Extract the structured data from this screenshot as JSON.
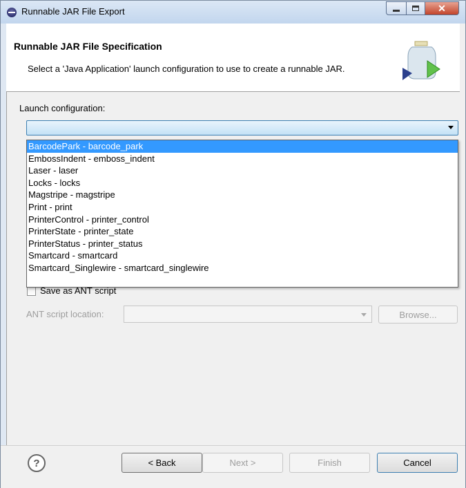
{
  "window": {
    "title": "Runnable JAR File Export",
    "minimize_icon": "minimize-icon",
    "maximize_icon": "maximize-icon",
    "close_icon": "close-icon"
  },
  "header": {
    "title": "Runnable JAR File Specification",
    "description": "Select a 'Java Application' launch configuration to use to create a runnable JAR.",
    "icon": "jar-export-icon"
  },
  "launch": {
    "label": "Launch configuration:",
    "selected_value": "",
    "options": [
      "BarcodePark - barcode_park",
      "EmbossIndent - emboss_indent",
      "Laser - laser",
      "Locks - locks",
      "Magstripe - magstripe",
      "Print - print",
      "PrinterControl - printer_control",
      "PrinterState - printer_state",
      "PrinterStatus - printer_status",
      "Smartcard - smartcard",
      "Smartcard_Singlewire - smartcard_singlewire"
    ],
    "highlighted_index": 0
  },
  "ant": {
    "save_label": "Save as ANT script",
    "location_label": "ANT script location:",
    "location_value": "",
    "browse_label": "Browse..."
  },
  "footer": {
    "help_icon": "help-icon",
    "back_label": "< Back",
    "next_label": "Next >",
    "finish_label": "Finish",
    "cancel_label": "Cancel"
  },
  "colors": {
    "selection": "#3399ff",
    "combo_focus_border": "#3c7fb1",
    "titlebar": "#c2d6ee",
    "close_button": "#c2442b"
  }
}
